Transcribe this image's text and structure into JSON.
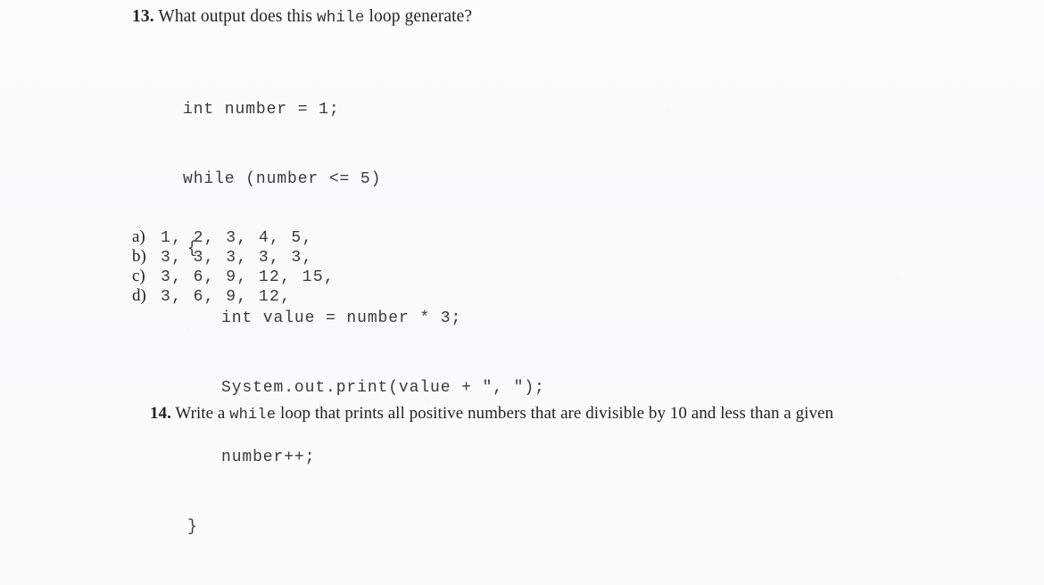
{
  "page": {
    "background_color": "#fbfbfc",
    "text_color": "#232325",
    "code_color": "#3a3a3d"
  },
  "question_13": {
    "number": "13.",
    "text_before_code": "What output does this",
    "inline_code": "while",
    "text_after_code": "loop generate?",
    "code_lines": [
      {
        "indent": 0,
        "text": "int number = 1;"
      },
      {
        "indent": 0,
        "text": "while (number <= 5)"
      },
      {
        "indent": 1,
        "text": "{"
      },
      {
        "indent": 2,
        "text": "int value = number * 3;"
      },
      {
        "indent": 2,
        "text": "System.out.print(value + \", \");"
      },
      {
        "indent": 2,
        "text": "number++;"
      },
      {
        "indent": 1,
        "text": "}"
      }
    ],
    "options": [
      {
        "label": "a)",
        "value": "1, 2, 3, 4, 5,"
      },
      {
        "label": "b)",
        "value": "3, 3, 3, 3, 3,"
      },
      {
        "label": "c)",
        "value": "3, 6, 9, 12, 15,"
      },
      {
        "label": "d)",
        "value": "3, 6, 9, 12,"
      }
    ]
  },
  "question_14": {
    "number": "14.",
    "text_before_code": "Write a",
    "inline_code": "while",
    "text_after_code": "loop that prints all positive numbers that are divisible  by 10 and less than a given"
  }
}
